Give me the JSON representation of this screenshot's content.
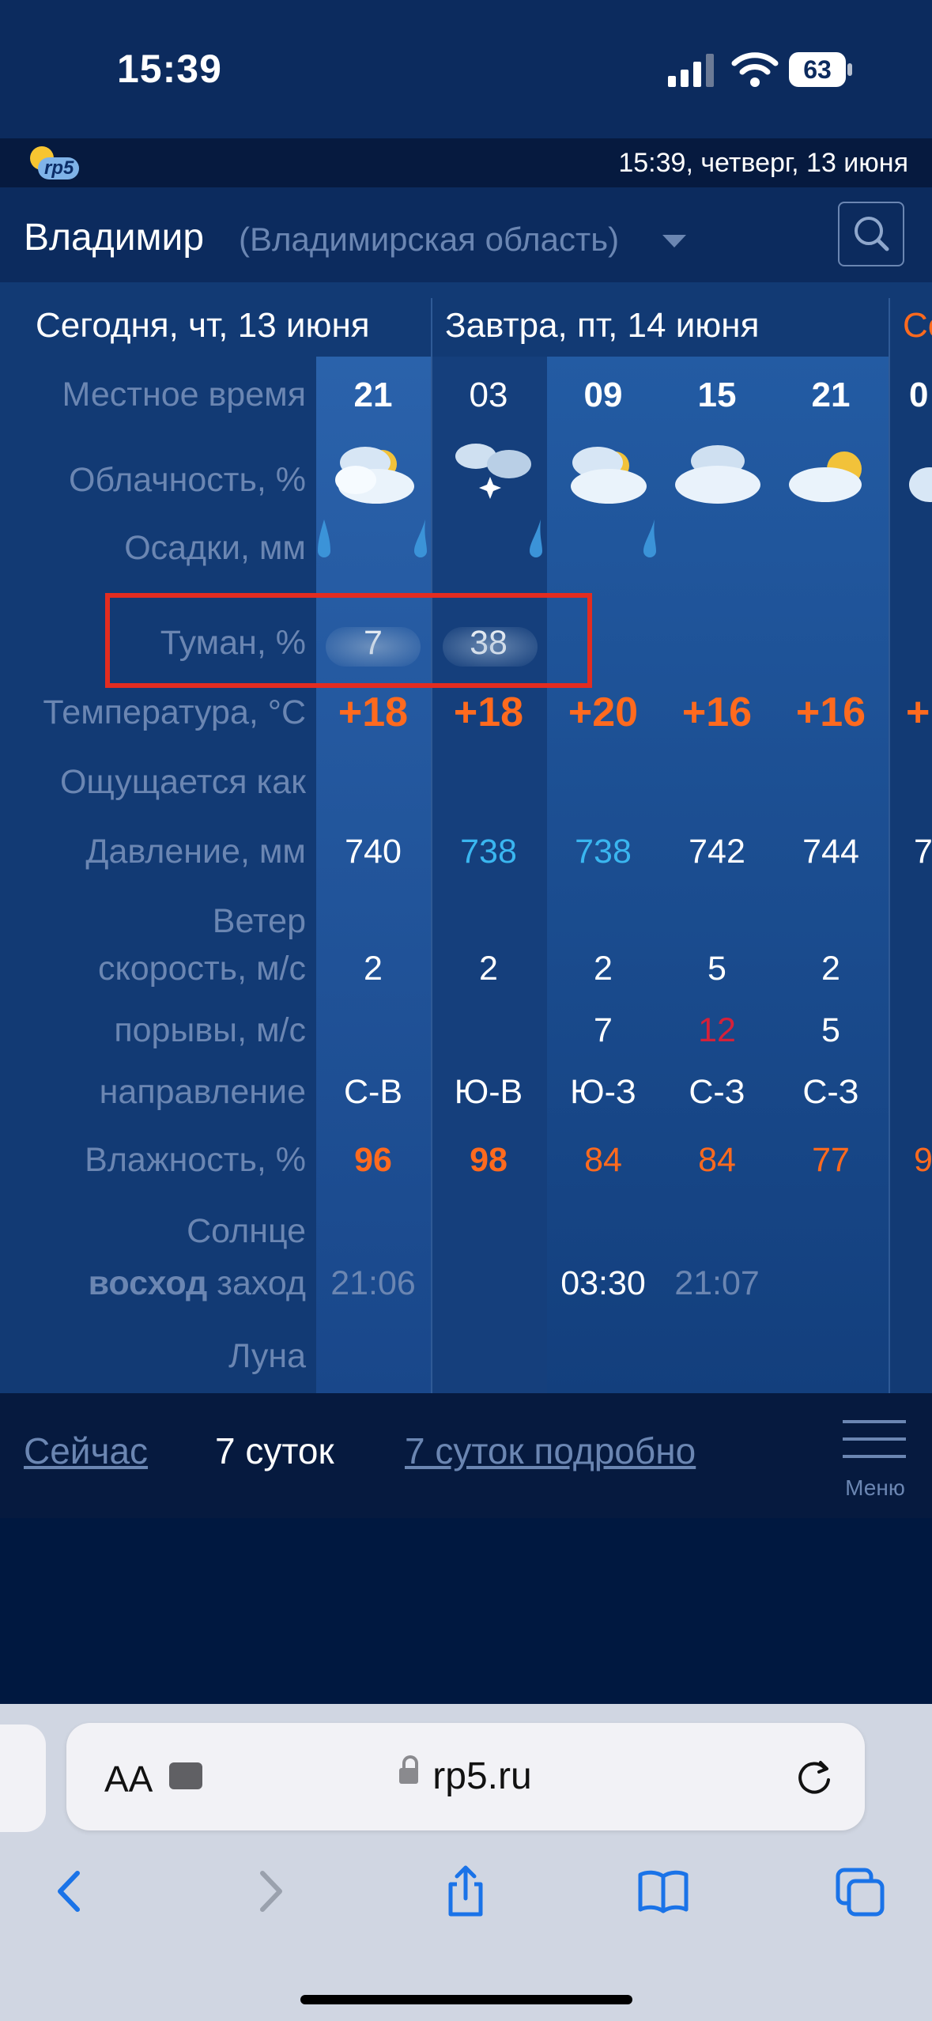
{
  "status_bar": {
    "time": "15:39",
    "battery": "63"
  },
  "top_strip": {
    "logo_text": "rp5",
    "datetime": "15:39, четверг, 13 июня"
  },
  "header": {
    "city": "Владимир",
    "region": "(Владимирская область)"
  },
  "days": {
    "today": "Сегодня, чт, 13 июня",
    "tomorrow": "Завтра, пт, 14 июня",
    "next_partial": "Се"
  },
  "labels": {
    "local_time": "Местное время",
    "cloudiness": "Облачность, %",
    "precip": "Осадки, мм",
    "fog": "Туман, %",
    "temperature": "Температура, °С",
    "feels_like": "Ощущается как",
    "pressure": "Давление, мм",
    "wind": "Ветер",
    "wind_speed": "скорость, м/с",
    "gusts": "порывы, м/с",
    "direction": "направление",
    "humidity": "Влажность, %",
    "sun": "Солнце",
    "sunrise": "восход",
    "sunset": "заход",
    "moon": "Луна"
  },
  "columns": [
    {
      "hour": "21",
      "fog": "7",
      "temp": "+18",
      "pressure": "740",
      "pressure_style": "white",
      "wind": "2",
      "gust": "",
      "gust_style": "white",
      "dir": "С-В",
      "humidity": "96",
      "humidity_style": "bold"
    },
    {
      "hour": "03",
      "fog": "38",
      "temp": "+18",
      "pressure": "738",
      "pressure_style": "blue",
      "wind": "2",
      "gust": "",
      "gust_style": "white",
      "dir": "Ю-В",
      "humidity": "98",
      "humidity_style": "bold"
    },
    {
      "hour": "09",
      "fog": "",
      "temp": "+20",
      "pressure": "738",
      "pressure_style": "blue",
      "wind": "2",
      "gust": "7",
      "gust_style": "white",
      "dir": "Ю-З",
      "humidity": "84",
      "humidity_style": "normal"
    },
    {
      "hour": "15",
      "fog": "",
      "temp": "+16",
      "pressure": "742",
      "pressure_style": "white",
      "wind": "5",
      "gust": "12",
      "gust_style": "red",
      "dir": "С-З",
      "humidity": "84",
      "humidity_style": "normal"
    },
    {
      "hour": "21",
      "fog": "",
      "temp": "+16",
      "pressure": "744",
      "pressure_style": "white",
      "wind": "2",
      "gust": "5",
      "gust_style": "white",
      "dir": "С-З",
      "humidity": "77",
      "humidity_style": "normal"
    }
  ],
  "partial_column": {
    "hour": "0",
    "temp": "+",
    "pressure": "7",
    "humidity": "9"
  },
  "sun": {
    "today_sunset": "21:06",
    "tomorrow_sunrise": "03:30",
    "tomorrow_sunset": "21:07"
  },
  "bottom_nav": {
    "now": "Сейчас",
    "seven_days": "7 суток",
    "seven_days_detailed": "7 суток подробно",
    "menu": "Меню"
  },
  "safari": {
    "text_size": "AA",
    "url": "rp5.ru"
  },
  "colors": {
    "accent_orange": "#ff6a1e",
    "pressure_blue": "#3ab6f0",
    "gust_red": "#d4213a",
    "highlight_red": "#e32c20"
  }
}
